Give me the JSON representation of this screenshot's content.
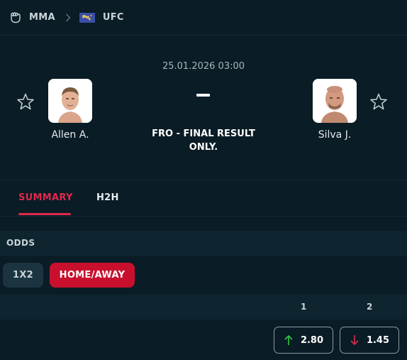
{
  "breadcrumb": {
    "sport_icon": "fist-icon",
    "sport": "MMA",
    "separator_icon": "chevron-right-icon",
    "league_flag": "world-flag-icon",
    "league": "UFC"
  },
  "event": {
    "datetime": "25.01.2026 03:00",
    "status_line1": "FRO - FINAL RESULT",
    "status_line2": "ONLY.",
    "home": {
      "name": "Allen A.",
      "favorite_icon": "star-outline-icon",
      "avatar": "fighter-photo"
    },
    "away": {
      "name": "Silva J.",
      "favorite_icon": "star-outline-icon",
      "avatar": "fighter-photo"
    }
  },
  "tabs": [
    {
      "label": "SUMMARY",
      "active": true
    },
    {
      "label": "H2H",
      "active": false
    }
  ],
  "odds": {
    "header": "ODDS",
    "market_buttons": [
      {
        "label": "1X2",
        "active": false
      },
      {
        "label": "HOME/AWAY",
        "active": true
      }
    ],
    "columns": [
      "1",
      "2"
    ],
    "values": [
      {
        "value": "2.80",
        "trend": "up",
        "trend_icon": "arrow-up-icon",
        "color": "#2ecc40"
      },
      {
        "value": "1.45",
        "trend": "down",
        "trend_icon": "arrow-down-icon",
        "color": "#e0284c"
      }
    ]
  },
  "colors": {
    "background": "#0a1c25",
    "accent": "#e0284c",
    "active_button": "#c8102e"
  }
}
